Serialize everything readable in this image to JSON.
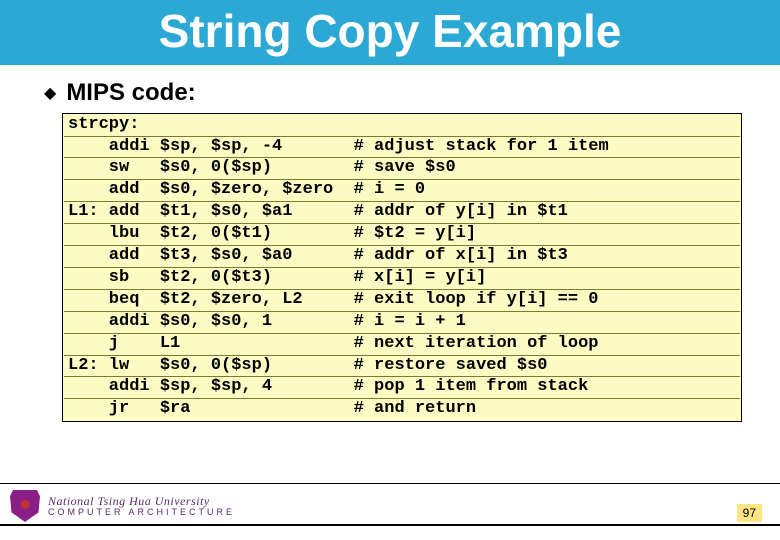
{
  "title": "String Copy Example",
  "bullet": "MIPS code:",
  "code_lines": [
    "strcpy:",
    "    addi $sp, $sp, -4       # adjust stack for 1 item",
    "    sw   $s0, 0($sp)        # save $s0",
    "    add  $s0, $zero, $zero  # i = 0",
    "L1: add  $t1, $s0, $a1      # addr of y[i] in $t1",
    "    lbu  $t2, 0($t1)        # $t2 = y[i]",
    "    add  $t3, $s0, $a0      # addr of x[i] in $t3",
    "    sb   $t2, 0($t3)        # x[i] = y[i]",
    "    beq  $t2, $zero, L2     # exit loop if y[i] == 0",
    "    addi $s0, $s0, 1        # i = i + 1",
    "    j    L1                 # next iteration of loop",
    "L2: lw   $s0, 0($sp)        # restore saved $s0",
    "    addi $sp, $sp, 4        # pop 1 item from stack",
    "    jr   $ra                # and return"
  ],
  "footer": {
    "uni_line1": "National Tsing Hua University",
    "uni_line2": "COMPUTER ARCHITECTURE",
    "page_number": "97"
  }
}
